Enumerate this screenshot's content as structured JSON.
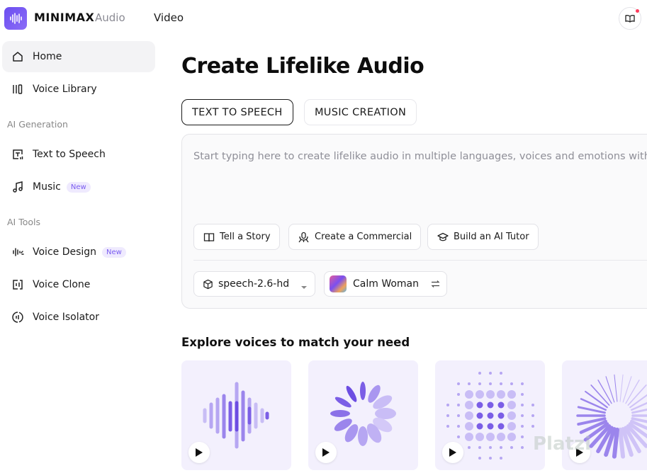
{
  "header": {
    "brand": "MINIMAX",
    "nav": {
      "audio": "Audio",
      "video": "Video"
    }
  },
  "sidebar": {
    "items": [
      {
        "label": "Home",
        "icon": "home-icon"
      },
      {
        "label": "Voice Library",
        "icon": "library-icon"
      }
    ],
    "sections": [
      {
        "label": "AI Generation",
        "items": [
          {
            "label": "Text to Speech",
            "icon": "text-speech-icon"
          },
          {
            "label": "Music",
            "icon": "music-icon",
            "badge": "New"
          }
        ]
      },
      {
        "label": "AI Tools",
        "items": [
          {
            "label": "Voice Design",
            "icon": "voice-design-icon",
            "badge": "New"
          },
          {
            "label": "Voice Clone",
            "icon": "voice-clone-icon"
          },
          {
            "label": "Voice Isolator",
            "icon": "voice-isolator-icon"
          }
        ]
      }
    ]
  },
  "main": {
    "title": "Create Lifelike Audio",
    "tabs": [
      {
        "label": "TEXT TO SPEECH"
      },
      {
        "label": "MUSIC CREATION"
      }
    ],
    "editor": {
      "placeholder": "Start typing here to create lifelike audio in multiple languages, voices and emotions with Mini",
      "suggestions": [
        {
          "label": "Tell a Story",
          "icon": "book-icon"
        },
        {
          "label": "Create a Commercial",
          "icon": "commercial-icon"
        },
        {
          "label": "Build an AI Tutor",
          "icon": "graduation-cap-icon"
        }
      ],
      "model": {
        "value": "speech-2.6-hd",
        "icon": "cube-icon"
      },
      "voice": {
        "value": "Calm Woman",
        "icon": "swap-icon"
      }
    },
    "explore": {
      "title": "Explore voices to match your need"
    }
  },
  "colors": {
    "accent": "#7a5cf0",
    "card_bg": "#f3f0fd",
    "badge_bg": "#efeafe"
  },
  "watermark": "Platzi"
}
